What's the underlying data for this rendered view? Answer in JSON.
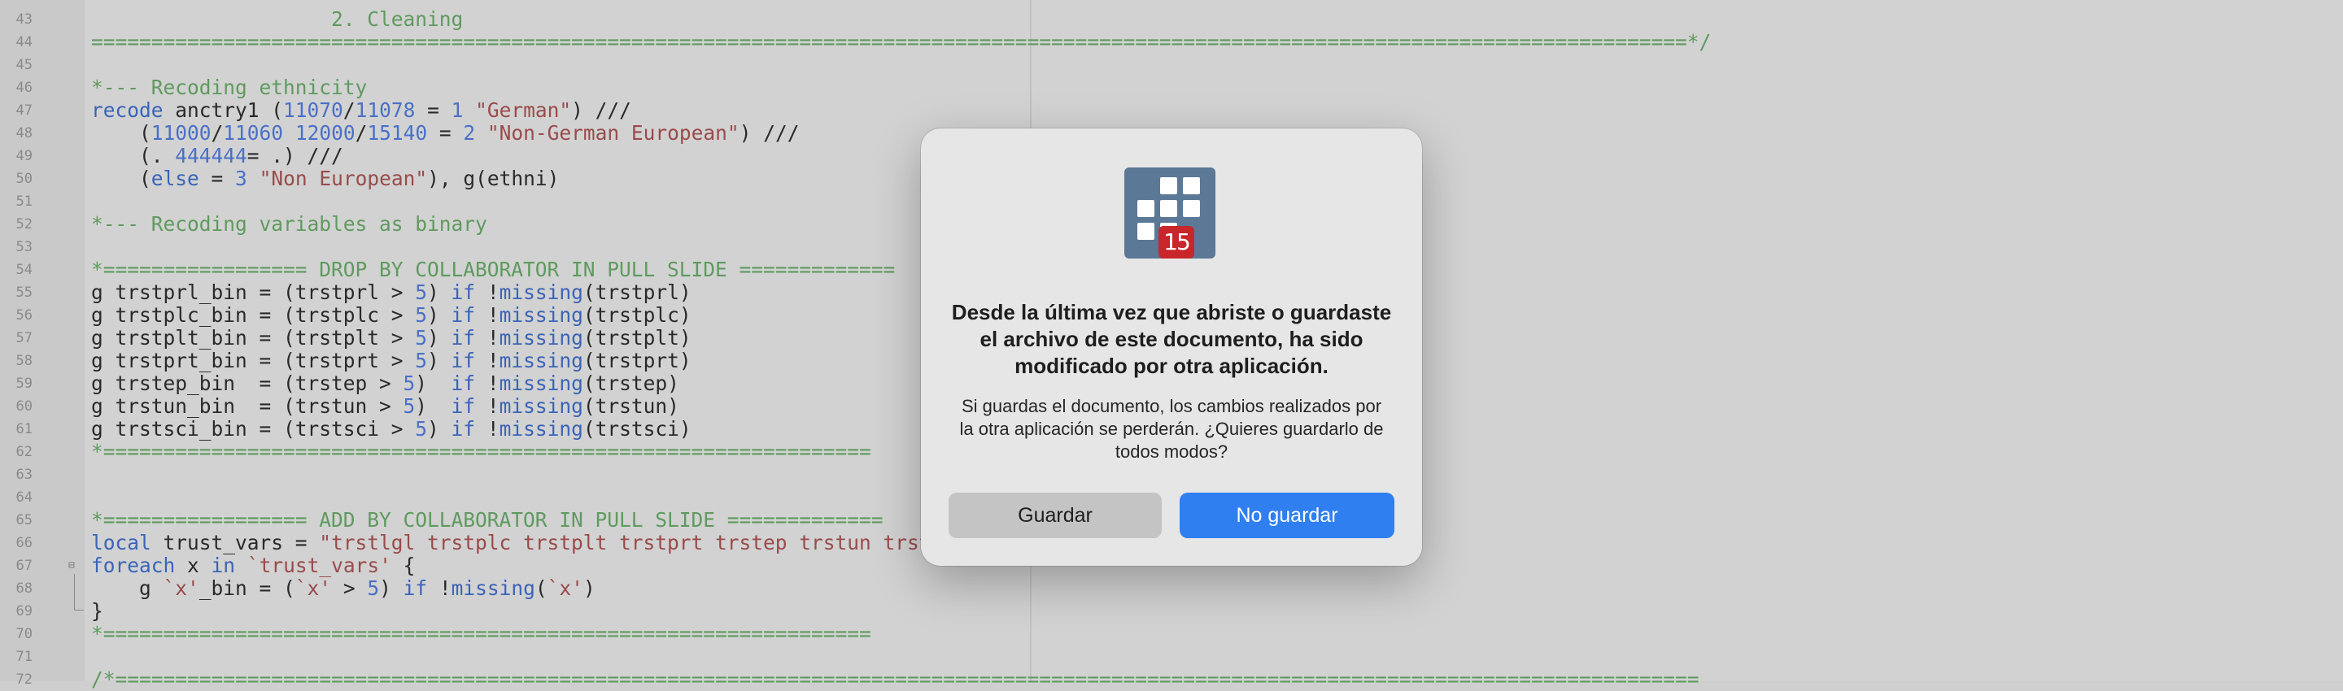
{
  "editor": {
    "lines": [
      {
        "n": "43",
        "parts": [
          {
            "t": "                    2. Cleaning",
            "c": "cm"
          }
        ]
      },
      {
        "n": "44",
        "parts": [
          {
            "t": "=====================================================================================================================================*/",
            "c": "cm"
          }
        ]
      },
      {
        "n": "45",
        "parts": []
      },
      {
        "n": "46",
        "parts": [
          {
            "t": "*--- Recoding ethnicity",
            "c": "cm"
          }
        ]
      },
      {
        "n": "47",
        "parts": [
          {
            "t": "recode",
            "c": "kw"
          },
          {
            "t": " anctry1 ("
          },
          {
            "t": "11070",
            "c": "num"
          },
          {
            "t": "/"
          },
          {
            "t": "11078",
            "c": "num"
          },
          {
            "t": " = "
          },
          {
            "t": "1",
            "c": "num"
          },
          {
            "t": " "
          },
          {
            "t": "\"German\"",
            "c": "str"
          },
          {
            "t": ") ///"
          }
        ]
      },
      {
        "n": "48",
        "parts": [
          {
            "t": "    ("
          },
          {
            "t": "11000",
            "c": "num"
          },
          {
            "t": "/"
          },
          {
            "t": "11060",
            "c": "num"
          },
          {
            "t": " "
          },
          {
            "t": "12000",
            "c": "num"
          },
          {
            "t": "/"
          },
          {
            "t": "15140",
            "c": "num"
          },
          {
            "t": " = "
          },
          {
            "t": "2",
            "c": "num"
          },
          {
            "t": " "
          },
          {
            "t": "\"Non-German European\"",
            "c": "str"
          },
          {
            "t": ") ///"
          }
        ]
      },
      {
        "n": "49",
        "parts": [
          {
            "t": "    (. "
          },
          {
            "t": "444444",
            "c": "num"
          },
          {
            "t": "= .) ///"
          }
        ]
      },
      {
        "n": "50",
        "parts": [
          {
            "t": "    ("
          },
          {
            "t": "else",
            "c": "kw"
          },
          {
            "t": " = "
          },
          {
            "t": "3",
            "c": "num"
          },
          {
            "t": " "
          },
          {
            "t": "\"Non European\"",
            "c": "str"
          },
          {
            "t": "), g(ethni)"
          }
        ]
      },
      {
        "n": "51",
        "parts": []
      },
      {
        "n": "52",
        "parts": [
          {
            "t": "*--- Recoding variables as binary",
            "c": "cm"
          }
        ]
      },
      {
        "n": "53",
        "parts": []
      },
      {
        "n": "54",
        "parts": [
          {
            "t": "*================= DROP BY COLLABORATOR IN PULL SLIDE =============",
            "c": "cm"
          }
        ]
      },
      {
        "n": "55",
        "parts": [
          {
            "t": "g trstprl_bin = (trstprl > "
          },
          {
            "t": "5",
            "c": "num"
          },
          {
            "t": ") "
          },
          {
            "t": "if",
            "c": "kw"
          },
          {
            "t": " !"
          },
          {
            "t": "missing",
            "c": "kw"
          },
          {
            "t": "(trstprl)"
          }
        ]
      },
      {
        "n": "56",
        "parts": [
          {
            "t": "g trstplc_bin = (trstplc > "
          },
          {
            "t": "5",
            "c": "num"
          },
          {
            "t": ") "
          },
          {
            "t": "if",
            "c": "kw"
          },
          {
            "t": " !"
          },
          {
            "t": "missing",
            "c": "kw"
          },
          {
            "t": "(trstplc)"
          }
        ]
      },
      {
        "n": "57",
        "parts": [
          {
            "t": "g trstplt_bin = (trstplt > "
          },
          {
            "t": "5",
            "c": "num"
          },
          {
            "t": ") "
          },
          {
            "t": "if",
            "c": "kw"
          },
          {
            "t": " !"
          },
          {
            "t": "missing",
            "c": "kw"
          },
          {
            "t": "(trstplt)"
          }
        ]
      },
      {
        "n": "58",
        "parts": [
          {
            "t": "g trstprt_bin = (trstprt > "
          },
          {
            "t": "5",
            "c": "num"
          },
          {
            "t": ") "
          },
          {
            "t": "if",
            "c": "kw"
          },
          {
            "t": " !"
          },
          {
            "t": "missing",
            "c": "kw"
          },
          {
            "t": "(trstprt)"
          }
        ]
      },
      {
        "n": "59",
        "parts": [
          {
            "t": "g trstep_bin  = (trstep > "
          },
          {
            "t": "5",
            "c": "num"
          },
          {
            "t": ")  "
          },
          {
            "t": "if",
            "c": "kw"
          },
          {
            "t": " !"
          },
          {
            "t": "missing",
            "c": "kw"
          },
          {
            "t": "(trstep)"
          }
        ]
      },
      {
        "n": "60",
        "parts": [
          {
            "t": "g trstun_bin  = (trstun > "
          },
          {
            "t": "5",
            "c": "num"
          },
          {
            "t": ")  "
          },
          {
            "t": "if",
            "c": "kw"
          },
          {
            "t": " !"
          },
          {
            "t": "missing",
            "c": "kw"
          },
          {
            "t": "(trstun)"
          }
        ]
      },
      {
        "n": "61",
        "parts": [
          {
            "t": "g trstsci_bin = (trstsci > "
          },
          {
            "t": "5",
            "c": "num"
          },
          {
            "t": ") "
          },
          {
            "t": "if",
            "c": "kw"
          },
          {
            "t": " !"
          },
          {
            "t": "missing",
            "c": "kw"
          },
          {
            "t": "(trstsci)"
          }
        ]
      },
      {
        "n": "62",
        "parts": [
          {
            "t": "*================================================================",
            "c": "cm"
          }
        ]
      },
      {
        "n": "63",
        "parts": []
      },
      {
        "n": "64",
        "parts": []
      },
      {
        "n": "65",
        "parts": [
          {
            "t": "*================= ADD BY COLLABORATOR IN PULL SLIDE =============",
            "c": "cm"
          }
        ]
      },
      {
        "n": "66",
        "parts": [
          {
            "t": "local",
            "c": "kw"
          },
          {
            "t": " trust_vars = "
          },
          {
            "t": "\"trstlgl trstplc trstplt trstprt trstep trstun trsts",
            "c": "str"
          }
        ]
      },
      {
        "n": "67",
        "parts": [
          {
            "t": "foreach",
            "c": "kw"
          },
          {
            "t": " x "
          },
          {
            "t": "in",
            "c": "kw"
          },
          {
            "t": " "
          },
          {
            "t": "`trust_vars'",
            "c": "str"
          },
          {
            "t": " {"
          }
        ],
        "fold": true
      },
      {
        "n": "68",
        "parts": [
          {
            "t": "    g "
          },
          {
            "t": "`x'",
            "c": "str"
          },
          {
            "t": "_bin = ("
          },
          {
            "t": "`x'",
            "c": "str"
          },
          {
            "t": " > "
          },
          {
            "t": "5",
            "c": "num"
          },
          {
            "t": ") "
          },
          {
            "t": "if",
            "c": "kw"
          },
          {
            "t": " !"
          },
          {
            "t": "missing",
            "c": "kw"
          },
          {
            "t": "("
          },
          {
            "t": "`x'",
            "c": "str"
          },
          {
            "t": ")"
          }
        ]
      },
      {
        "n": "69",
        "parts": [
          {
            "t": "}"
          }
        ]
      },
      {
        "n": "70",
        "parts": [
          {
            "t": "*================================================================",
            "c": "cm"
          }
        ]
      },
      {
        "n": "71",
        "parts": []
      },
      {
        "n": "72",
        "parts": [
          {
            "t": "/*====================================================================================================================================",
            "c": "cm"
          }
        ]
      }
    ]
  },
  "dialog": {
    "icon": "app-grid-icon",
    "badge": "15",
    "title": "Desde la última vez que abriste o guardaste el archivo de este documento, ha sido modificado por otra aplicación.",
    "message": "Si guardas el documento, los cambios realizados por la otra aplicación se perderán. ¿Quieres guardarlo de todos modos?",
    "save_label": "Guardar",
    "dont_save_label": "No guardar"
  }
}
